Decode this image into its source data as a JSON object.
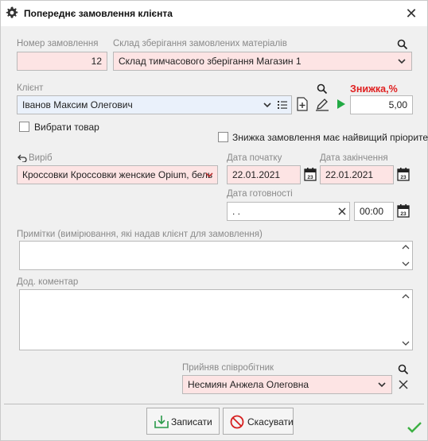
{
  "window": {
    "title": "Попереднє замовлення клієнта"
  },
  "order": {
    "number_label": "Номер замовлення",
    "number_value": "12",
    "warehouse_label": "Склад зберігання замовлених матеріалів",
    "warehouse_value": "Склад тимчасового зберігання Магазин 1"
  },
  "client": {
    "label": "Клієнт",
    "value": "Іванов Максим Олегович",
    "discount_label": "Знижка,%",
    "discount_value": "5,00",
    "select_product_label": "Вибрати товар",
    "priority_label": "Знижка замовлення має найвищий пріоритет"
  },
  "product": {
    "label": "Виріб",
    "value": "Кроссовки Кроссовки женские Opium,  бель"
  },
  "dates": {
    "start_label": "Дата початку",
    "start_value": "22.01.2021",
    "end_label": "Дата закінчення",
    "end_value": "22.01.2021",
    "ready_label": "Дата готовності",
    "ready_value": " .  .",
    "ready_time": "00:00",
    "calendar_day": "23"
  },
  "notes": {
    "label": "Примітки (вимірювання, які надав клієнт для замовлення)",
    "value": ""
  },
  "comment": {
    "label": "Дод. коментар",
    "value": ""
  },
  "employee": {
    "label": "Прийняв співробітник",
    "value": "Несмиян Анжела Олеговна"
  },
  "buttons": {
    "save": "Записати",
    "cancel": "Скасувати"
  },
  "colors": {
    "required_bg": "#fde4e4",
    "discount_red": "#e02020",
    "play_green": "#22aa44",
    "ok_green": "#3cb043"
  },
  "icons": [
    "gear-icon",
    "close-icon",
    "search-icon",
    "chevron-down-icon",
    "list-icon",
    "add-document-icon",
    "edit-icon",
    "play-icon",
    "undo-arrow-icon",
    "calendar-icon",
    "clear-icon",
    "scroll-up-icon",
    "scroll-down-icon",
    "save-icon",
    "cancel-icon",
    "checkmark-icon"
  ]
}
